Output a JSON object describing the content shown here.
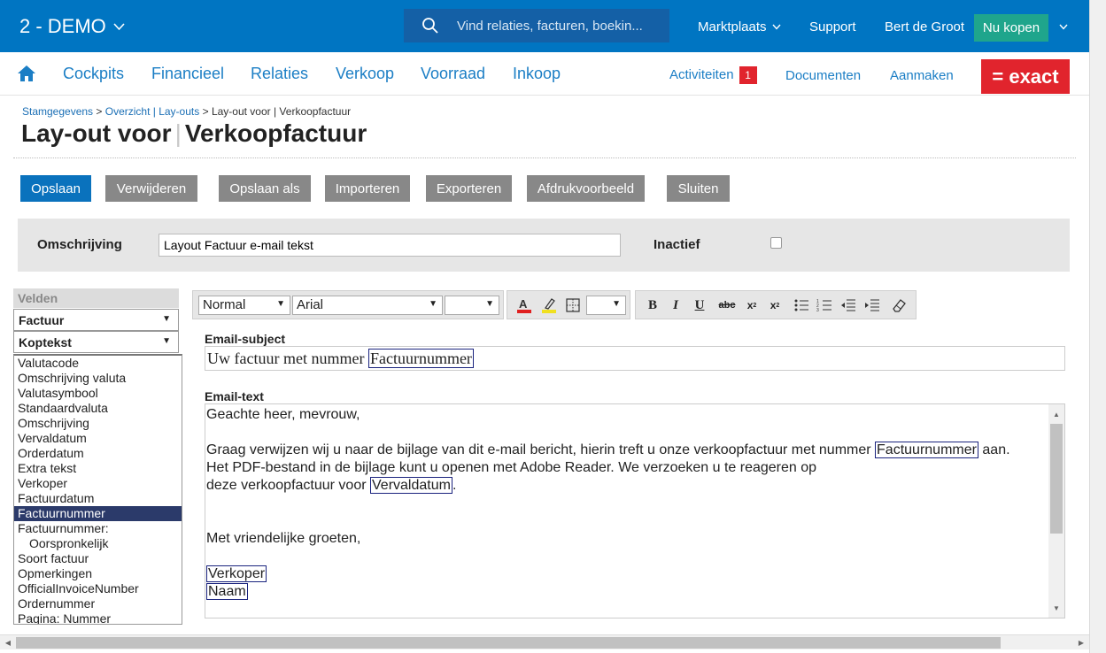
{
  "topbar": {
    "company": "2 - DEMO",
    "search_placeholder": "Vind relaties, facturen, boekin...",
    "marketplace": "Marktplaats",
    "support": "Support",
    "user": "Bert de Groot",
    "buy_now": "Nu kopen",
    "brand_color": "#0075c2"
  },
  "nav": {
    "items": [
      "Cockpits",
      "Financieel",
      "Relaties",
      "Verkoop",
      "Voorraad",
      "Inkoop"
    ],
    "activities": "Activiteiten",
    "activities_count": "1",
    "documents": "Documenten",
    "create": "Aanmaken",
    "logo": "= exact"
  },
  "breadcrumb": {
    "items": [
      "Stamgegevens",
      "Overzicht | Lay-outs"
    ],
    "current": "Lay-out voor | Verkoopfactuur"
  },
  "title": {
    "part1": "Lay-out voor",
    "part2": "Verkoopfactuur"
  },
  "actions": {
    "save": "Opslaan",
    "delete": "Verwijderen",
    "save_as": "Opslaan als",
    "import": "Importeren",
    "export": "Exporteren",
    "preview": "Afdrukvoorbeeld",
    "close": "Sluiten"
  },
  "form": {
    "description_label": "Omschrijving",
    "description_value": "Layout Factuur e-mail tekst",
    "inactive_label": "Inactief"
  },
  "fields": {
    "header": "Velden",
    "dropdown1": "Factuur",
    "dropdown2": "Koptekst",
    "items": [
      "Valutacode",
      "Omschrijving valuta",
      "Valutasymbool",
      "Standaardvaluta",
      "Omschrijving",
      "Vervaldatum",
      "Orderdatum",
      "Extra tekst",
      "Verkoper",
      "Factuurdatum",
      "Factuurnummer",
      "Factuurnummer:",
      "Oorspronkelijk",
      "Soort factuur",
      "Opmerkingen",
      "OfficialInvoiceNumber",
      "Ordernummer",
      "Pagina: Nummer"
    ],
    "selected": "Factuurnummer"
  },
  "editor": {
    "style": "Normal",
    "font": "Arial",
    "subject_label": "Email-subject",
    "subject_text": "Uw factuur met nummer",
    "subject_token": "Factuurnummer",
    "text_label": "Email-text",
    "l1": "Geachte heer, mevrouw,",
    "l2a": "Graag verwijzen wij u naar de bijlage van dit e-mail bericht, hierin treft u onze verkoopfactuur met nummer",
    "l2tok": "Factuurnummer",
    "l2b": "aan.",
    "l3": "Het PDF-bestand in de bijlage kunt u openen met Adobe Reader. We verzoeken u te reageren op",
    "l4a": "deze verkoopfactuur voor",
    "l4tok": "Vervaldatum",
    "l4b": ".",
    "l5": "Met vriendelijke groeten,",
    "t1": "Verkoper",
    "t2": "Naam"
  }
}
